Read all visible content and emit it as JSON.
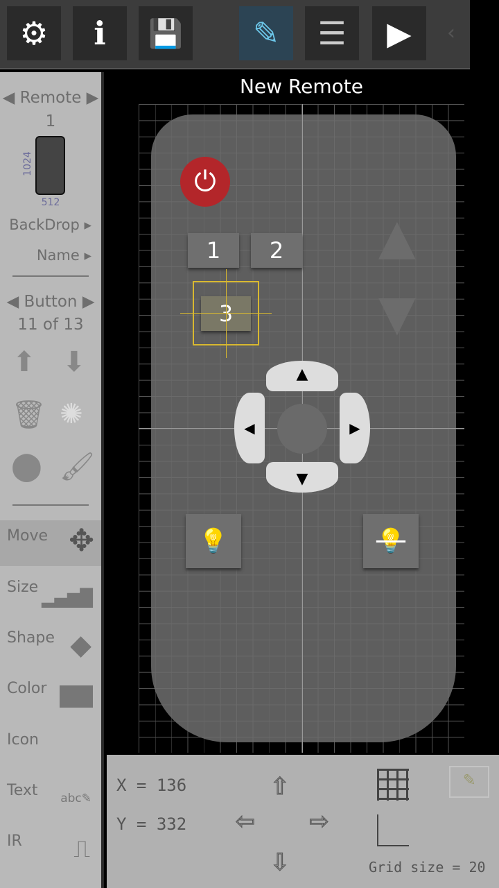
{
  "toolbar": {
    "items": [
      {
        "name": "settings",
        "icon": "gears-icon",
        "glyph": "⚙"
      },
      {
        "name": "info",
        "icon": "info-icon",
        "glyph": "i"
      },
      {
        "name": "save",
        "icon": "floppy-icon",
        "glyph": "💾"
      },
      {
        "name": "edit",
        "icon": "pencil-icon",
        "glyph": "✎",
        "active": true
      },
      {
        "name": "list",
        "icon": "list-icon",
        "glyph": "☰"
      },
      {
        "name": "play",
        "icon": "play-icon",
        "glyph": "▶"
      }
    ],
    "chevron": "‹"
  },
  "title": "New Remote",
  "left": {
    "remote_label": "Remote",
    "remote_number": "1",
    "height": "1024",
    "width": "512",
    "backdrop": "BackDrop ▸",
    "name": "Name ▸",
    "button_label": "Button",
    "button_count": "11 of 13",
    "tools": [
      {
        "label": "Move",
        "glyph": "✥"
      },
      {
        "label": "Size",
        "glyph": "▂▄▆█"
      },
      {
        "label": "Shape",
        "glyph": "◆"
      },
      {
        "label": "Color",
        "glyph": "▬"
      },
      {
        "label": "Icon",
        "glyph": ""
      },
      {
        "label": "Text",
        "glyph": "abc✎"
      },
      {
        "label": "IR",
        "glyph": "⎍"
      }
    ]
  },
  "remote": {
    "buttons": [
      "1",
      "2",
      "3"
    ],
    "power": "⏻",
    "up": "▲",
    "down": "▼",
    "left": "◀",
    "right": "▶",
    "bulb": "💡",
    "colors": {
      "power": "#b3262a",
      "selection": "#d8b830"
    }
  },
  "bottom": {
    "x_label": "X  =",
    "x_value": "136",
    "y_label": "Y  =",
    "y_value": "332",
    "grid_label": "Grid size =",
    "grid_value": "20"
  }
}
